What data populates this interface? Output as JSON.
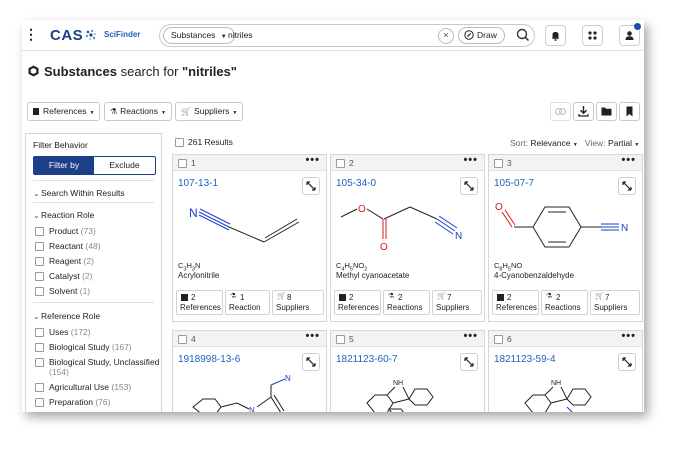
{
  "header": {
    "logo_text": "CAS",
    "product": "SciFinder",
    "scope_label": "Substances",
    "query_value": "nitriles",
    "draw_label": "Draw"
  },
  "page": {
    "title_prefix": "Substances",
    "title_middle": " search for ",
    "title_query": "\"nitriles\""
  },
  "toolbar": {
    "references_label": "References",
    "reactions_label": "Reactions",
    "suppliers_label": "Suppliers"
  },
  "filters": {
    "heading": "Filter Behavior",
    "filter_by_label": "Filter by",
    "exclude_label": "Exclude",
    "search_within_label": "Search Within Results",
    "reaction_role_label": "Reaction Role",
    "reaction_roles": [
      {
        "label": "Product",
        "count": "(73)"
      },
      {
        "label": "Reactant",
        "count": "(48)"
      },
      {
        "label": "Reagent",
        "count": "(2)"
      },
      {
        "label": "Catalyst",
        "count": "(2)"
      },
      {
        "label": "Solvent",
        "count": "(1)"
      }
    ],
    "reference_role_label": "Reference Role",
    "reference_roles": [
      {
        "label": "Uses",
        "count": "(172)"
      },
      {
        "label": "Biological Study",
        "count": "(167)"
      },
      {
        "label": "Biological Study, Unclassified",
        "count": "(154)"
      },
      {
        "label": "Agricultural Use",
        "count": "(153)"
      },
      {
        "label": "Preparation",
        "count": "(76)"
      }
    ]
  },
  "results": {
    "count_label": "261 Results",
    "sort_label": "Sort:",
    "sort_value": "Relevance",
    "view_label": "View:",
    "view_value": "Partial"
  },
  "cards": [
    {
      "index": "1",
      "cas": "107-13-1",
      "formula": [
        "C",
        "3",
        "H",
        "3",
        "N",
        ""
      ],
      "name": "Acrylonitrile",
      "refs": "2",
      "refs_label": "References",
      "rxns": "1",
      "rxns_label": "Reaction",
      "sups": "8",
      "sups_label": "Suppliers"
    },
    {
      "index": "2",
      "cas": "105-34-0",
      "formula": [
        "C",
        "4",
        "H",
        "5",
        "NO",
        "2"
      ],
      "name": "Methyl cyanoacetate",
      "refs": "2",
      "refs_label": "References",
      "rxns": "2",
      "rxns_label": "Reactions",
      "sups": "7",
      "sups_label": "Suppliers"
    },
    {
      "index": "3",
      "cas": "105-07-7",
      "formula": [
        "C",
        "8",
        "H",
        "5",
        "NO",
        ""
      ],
      "name": "4-Cyanobenzaldehyde",
      "refs": "2",
      "refs_label": "References",
      "rxns": "2",
      "rxns_label": "Reactions",
      "sups": "7",
      "sups_label": "Suppliers"
    },
    {
      "index": "4",
      "cas": "1918998-13-6"
    },
    {
      "index": "5",
      "cas": "1821123-60-7"
    },
    {
      "index": "6",
      "cas": "1821123-59-4"
    }
  ],
  "atoms": {
    "n": "N",
    "o": "O",
    "nh": "NH"
  },
  "colors": {
    "brand": "#1d3f87",
    "link": "#1d62c0",
    "nitrogen": "#1a3fc9",
    "oxygen": "#d81b1b"
  }
}
